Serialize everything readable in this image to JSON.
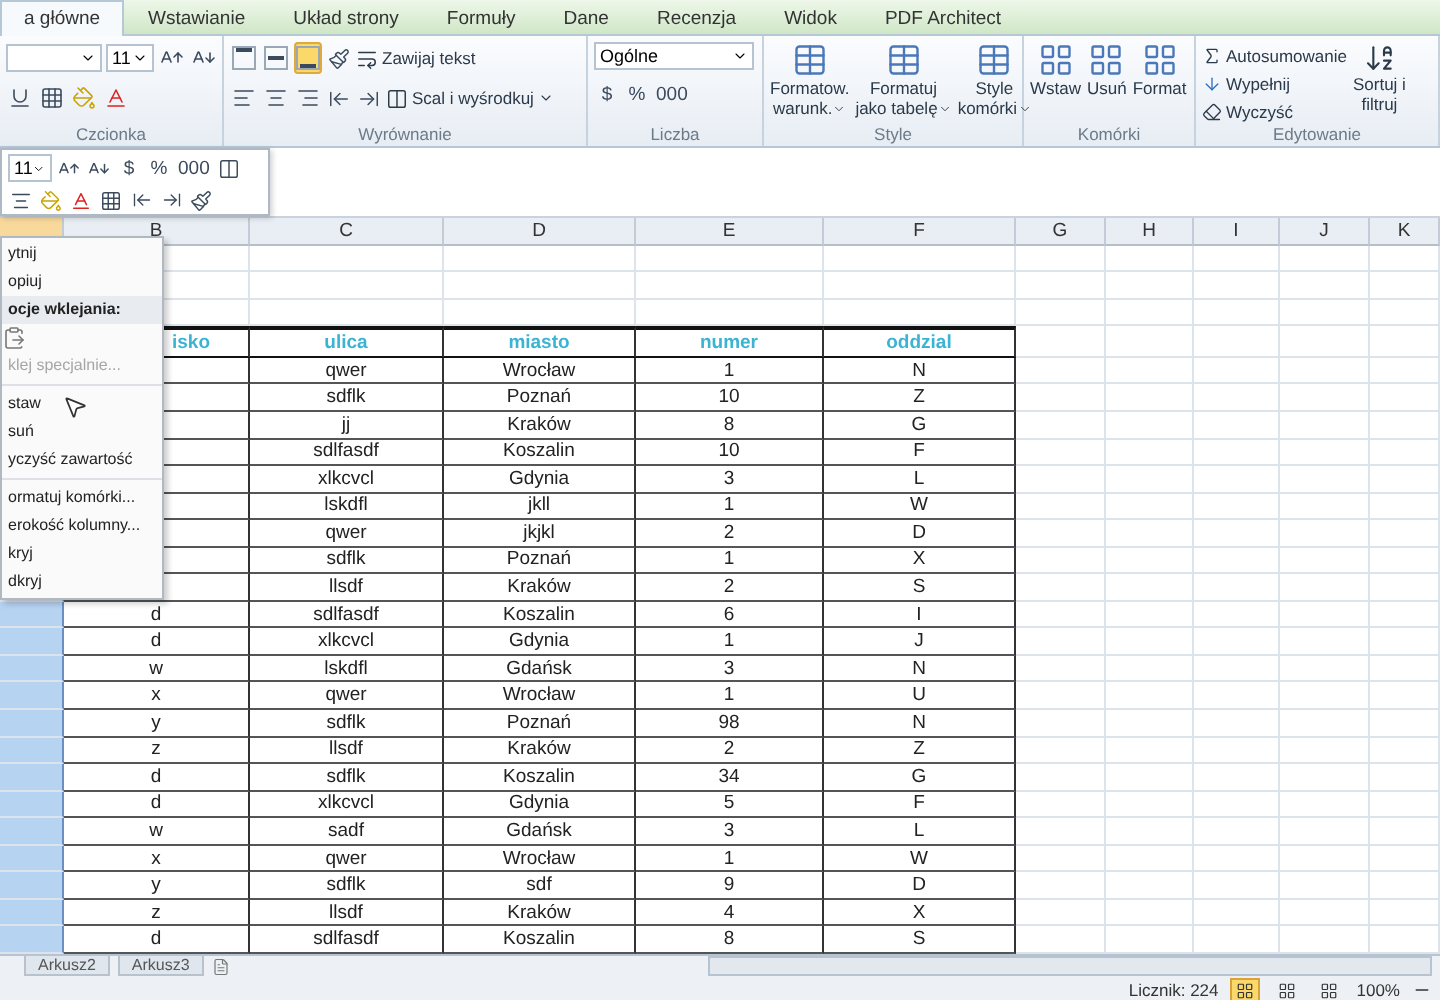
{
  "ribbon_tabs": [
    {
      "label": "a główne",
      "selected": true
    },
    {
      "label": "Wstawianie",
      "selected": false
    },
    {
      "label": "Układ strony",
      "selected": false
    },
    {
      "label": "Formuły",
      "selected": false
    },
    {
      "label": "Dane",
      "selected": false
    },
    {
      "label": "Recenzja",
      "selected": false
    },
    {
      "label": "Widok",
      "selected": false
    },
    {
      "label": "PDF Architect",
      "selected": false
    }
  ],
  "ribbon": {
    "font_group": {
      "label": "Czcionka",
      "font_size": "11"
    },
    "alignment_group": {
      "label": "Wyrównanie",
      "wrap_text": "Zawijaj tekst",
      "merge_center": "Scal i wyśrodkuj",
      "vertical_align": [
        {
          "kind": "top",
          "selected": false
        },
        {
          "kind": "middle",
          "selected": false
        },
        {
          "kind": "bottom",
          "selected": true
        }
      ]
    },
    "number_group": {
      "label": "Liczba",
      "format": "Ogólne",
      "buttons": [
        "$",
        "%",
        "000"
      ]
    },
    "styles_group": {
      "label": "Style",
      "buttons": [
        {
          "line1": "Formatow.",
          "line2": "warunk."
        },
        {
          "line1": "Formatuj",
          "line2": "jako tabelę"
        },
        {
          "line1": "Style",
          "line2": "komórki"
        }
      ]
    },
    "cells_group": {
      "label": "Komórki",
      "buttons": [
        "Wstaw",
        "Usuń",
        "Format"
      ]
    },
    "editing_group": {
      "label": "Edytowanie",
      "autosum": "Autosumowanie",
      "fill": "Wypełnij",
      "clear": "Wyczyść",
      "sort_line1": "Sortuj i",
      "sort_line2": "filtruj"
    }
  },
  "mini_toolbar": {
    "font_size": "11",
    "buttons": [
      "$",
      "%",
      "000"
    ]
  },
  "columns": [
    {
      "selected": true
    },
    {
      "label": "B",
      "selected": false
    },
    {
      "label": "C",
      "selected": false
    },
    {
      "label": "D",
      "selected": false
    },
    {
      "label": "E",
      "selected": false
    },
    {
      "label": "F",
      "selected": false
    },
    {
      "label": "G",
      "selected": false
    },
    {
      "label": "H",
      "selected": false
    },
    {
      "label": "I",
      "selected": false
    },
    {
      "label": "J",
      "selected": false
    },
    {
      "label": "K",
      "selected": false
    }
  ],
  "table": {
    "headers": [
      "isko",
      "ulica",
      "miasto",
      "numer",
      "oddzial"
    ],
    "rows": [
      {
        "c": "qwer",
        "d": "Wrocław",
        "e": "1",
        "f": "N"
      },
      {
        "c": "sdflk",
        "d": "Poznań",
        "e": "10",
        "f": "Z"
      },
      {
        "c": "jj",
        "d": "Kraków",
        "e": "8",
        "f": "G"
      },
      {
        "c": "sdlfasdf",
        "d": "Koszalin",
        "e": "10",
        "f": "F"
      },
      {
        "c": "xlkcvcl",
        "d": "Gdynia",
        "e": "3",
        "f": "L"
      },
      {
        "c": "lskdfl",
        "d": "jkll",
        "e": "1",
        "f": "W"
      },
      {
        "c": "qwer",
        "d": "jkjkl",
        "e": "2",
        "f": "D"
      },
      {
        "c": "sdflk",
        "d": "Poznań",
        "e": "1",
        "f": "X"
      },
      {
        "c": "llsdf",
        "d": "Kraków",
        "e": "2",
        "f": "S"
      },
      {
        "b": "d",
        "c": "sdlfasdf",
        "d": "Koszalin",
        "e": "6",
        "f": "I"
      },
      {
        "b": "d",
        "c": "xlkcvcl",
        "d": "Gdynia",
        "e": "1",
        "f": "J"
      },
      {
        "b": "w",
        "c": "lskdfl",
        "d": "Gdańsk",
        "e": "3",
        "f": "N"
      },
      {
        "b": "x",
        "c": "qwer",
        "d": "Wrocław",
        "e": "1",
        "f": "U"
      },
      {
        "b": "y",
        "c": "sdflk",
        "d": "Poznań",
        "e": "98",
        "f": "N"
      },
      {
        "b": "z",
        "c": "llsdf",
        "d": "Kraków",
        "e": "2",
        "f": "Z"
      },
      {
        "b": "d",
        "c": "sdflk",
        "d": "Koszalin",
        "e": "34",
        "f": "G"
      },
      {
        "b": "d",
        "c": "xlkcvcl",
        "d": "Gdynia",
        "e": "5",
        "f": "F"
      },
      {
        "b": "w",
        "c": "sadf",
        "d": "Gdańsk",
        "e": "3",
        "f": "L"
      },
      {
        "b": "x",
        "c": "qwer",
        "d": "Wrocław",
        "e": "1",
        "f": "W"
      },
      {
        "b": "y",
        "c": "sdflk",
        "d": "sdf",
        "e": "9",
        "f": "D"
      },
      {
        "b": "z",
        "c": "llsdf",
        "d": "Kraków",
        "e": "4",
        "f": "X"
      },
      {
        "b": "d",
        "c": "sdlfasdf",
        "d": "Koszalin",
        "e": "8",
        "f": "S"
      }
    ]
  },
  "context_menu": [
    {
      "kind": "item",
      "label": "ytnij"
    },
    {
      "kind": "item",
      "label": "opiuj"
    },
    {
      "kind": "header",
      "label": "ocje wklejania:"
    },
    {
      "kind": "paste_options"
    },
    {
      "kind": "disabled",
      "label": "klej specjalnie..."
    },
    {
      "kind": "separator"
    },
    {
      "kind": "item",
      "label": "staw"
    },
    {
      "kind": "item",
      "label": "suń"
    },
    {
      "kind": "item",
      "label": "yczyść zawartość"
    },
    {
      "kind": "separator"
    },
    {
      "kind": "item",
      "label": "ormatuj komórki..."
    },
    {
      "kind": "item",
      "label": "erokość kolumny..."
    },
    {
      "kind": "item",
      "label": "kryj"
    },
    {
      "kind": "item",
      "label": "dkryj"
    }
  ],
  "sheet_tabs": [
    "Arkusz2",
    "Arkusz3"
  ],
  "status_bar": {
    "count": "Licznik: 224",
    "views": [
      {
        "selected": true
      },
      {
        "selected": false
      },
      {
        "selected": false
      }
    ],
    "zoom": "100%"
  }
}
